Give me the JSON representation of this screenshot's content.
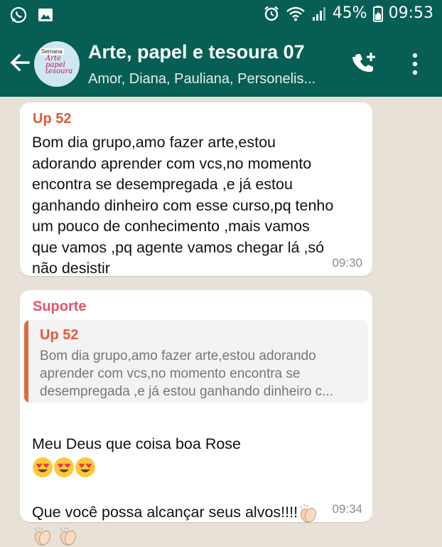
{
  "status_bar": {
    "battery": "45%",
    "time": "09:53",
    "icons": [
      "whatsapp-icon",
      "image-icon",
      "alarm-icon",
      "wifi-icon",
      "signal-icon",
      "battery-icon"
    ]
  },
  "header": {
    "title": "Arte, papel e tesoura 07",
    "subtitle": "Amor, Diana, Pauliana, Personelis...",
    "avatar_label": "Arte papel tesoura",
    "avatar_tag": "Semana",
    "icons": [
      "back-arrow-icon",
      "add-call-icon",
      "more-vert-icon"
    ]
  },
  "colors": {
    "header_bg": "#075e54",
    "chat_bg": "#e8e1d8",
    "sender1": "#e05a3a",
    "sender2": "#e0566b",
    "quote_bar": "#e06b3a"
  },
  "messages": [
    {
      "sender": "Up 52",
      "text": "Bom dia grupo,amo fazer arte,estou\nadorando aprender com vcs,no momento\nencontra se desempregada ,e já estou\nganhando dinheiro com esse curso,pq tenho\num pouco de conhecimento ,mais vamos\nque vamos ,pq agente vamos chegar lá ,só\nnão desistir",
      "time": "09:30"
    },
    {
      "sender": "Suporte",
      "quote_author": "Up 52",
      "quote_text": "Bom dia grupo,amo fazer arte,estou adorando\naprender com vcs,no momento encontra se\ndesempregada ,e já estou ganhando dinheiro c...",
      "line1": "Meu Deus que coisa boa Rose",
      "line2": "Que você possa alcançar seus alvos!!!!",
      "time": "09:34",
      "emojis": [
        "heart-eyes-emoji",
        "heart-eyes-emoji",
        "heart-eyes-emoji",
        "clapping-hands-emoji",
        "clapping-hands-emoji",
        "clapping-hands-emoji"
      ]
    }
  ]
}
